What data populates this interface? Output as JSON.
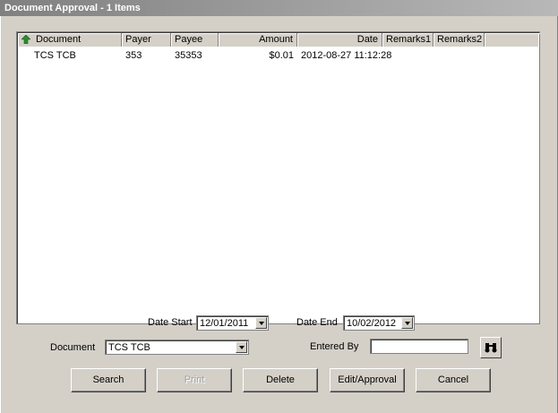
{
  "window": {
    "title": "Document Approval - 1 Items"
  },
  "list": {
    "columns": [
      "Document",
      "Payer",
      "Payee",
      "Amount",
      "Date",
      "Remarks1",
      "Remarks2"
    ],
    "rows": [
      {
        "document": "TCS TCB",
        "payer": "353",
        "payee": "35353",
        "amount": "$0.01",
        "date": "2012-08-27 11:12:28",
        "remarks1": "",
        "remarks2": ""
      }
    ]
  },
  "filters": {
    "date_start_label": "Date Start",
    "date_start_value": "12/01/2011",
    "date_end_label": "Date End",
    "date_end_value": "10/02/2012",
    "document_label": "Document",
    "document_value": "TCS TCB",
    "entered_by_label": "Entered By",
    "entered_by_value": ""
  },
  "buttons": {
    "search": "Search",
    "print": "Print",
    "delete": "Delete",
    "edit_approval": "Edit/Approval",
    "cancel": "Cancel"
  },
  "icons": {
    "sort": "sort-up-arrow-icon",
    "find": "binoculars-icon"
  },
  "colors": {
    "sort_arrow": "#2e8b2e",
    "title_bar": "#9a9a9a",
    "window_bg": "#d4d0c8"
  }
}
